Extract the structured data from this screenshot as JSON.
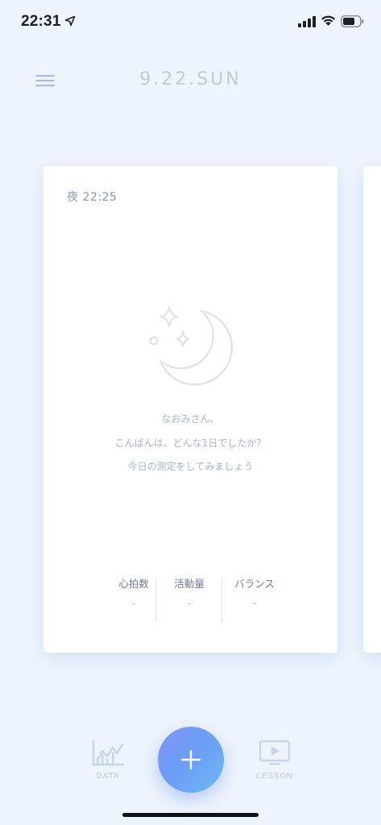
{
  "status_bar": {
    "time": "22:31",
    "icons": [
      "location-arrow-icon",
      "signal-bars-icon",
      "wifi-icon",
      "battery-icon"
    ]
  },
  "header": {
    "menu_icon": "hamburger-menu-icon",
    "title": "9.22.SUN"
  },
  "card": {
    "time": "夜 22:25",
    "illustration_icon": "moon-stars-icon",
    "greeting_lines": [
      "なおみさん、",
      "こんばんは、どんな1日でしたか？",
      "今日の測定をしてみましょう"
    ],
    "metrics": [
      {
        "label": "心拍数",
        "value": "-"
      },
      {
        "label": "活動量",
        "value": "-"
      },
      {
        "label": "バランス",
        "value": "-"
      }
    ]
  },
  "tab_bar": {
    "data_label": "DATA",
    "data_icon": "line-chart-icon",
    "add_icon": "plus-icon",
    "lesson_label": "LESSON",
    "lesson_icon": "video-play-icon"
  },
  "colors": {
    "background": "#eef4fd",
    "card": "#ffffff",
    "accent_start": "#7f95f6",
    "accent_end": "#6fb9f4",
    "muted_text": "#aab4c7"
  }
}
